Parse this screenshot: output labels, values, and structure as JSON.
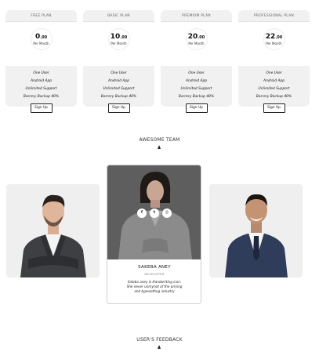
{
  "pricing": {
    "plans": [
      {
        "name": "FREE PLAN",
        "price": "0",
        "cents": ".00",
        "period": "Per Month",
        "features": [
          "One User",
          "Android App",
          "Unlimited Support",
          "Barrery Backup 40%"
        ],
        "cta": "Sign Up"
      },
      {
        "name": "BASIC PLAN",
        "price": "10",
        "cents": ".00",
        "period": "Per Month",
        "features": [
          "One User",
          "Android App",
          "Unlimited Support",
          "Barrery Backup 40%"
        ],
        "cta": "Sign Up"
      },
      {
        "name": "PREMIUM PLAN",
        "price": "20",
        "cents": ".00",
        "period": "Per Month",
        "features": [
          "One User",
          "Android App",
          "Unlimited Support",
          "Barrery Backup 40%"
        ],
        "cta": "Sign Up"
      },
      {
        "name": "PROFESSIONAL PLAN",
        "price": "22",
        "cents": ".00",
        "period": "Per Month",
        "features": [
          "One User",
          "Android App",
          "Unlimited Support",
          "Barrery Backup 40%"
        ],
        "cta": "Sign Up"
      }
    ]
  },
  "team": {
    "title": "AWESOME TEAM",
    "featured": {
      "name": "SAKEBA ANEY",
      "role": "DEVELOPER",
      "bio": "Saleba aney is Handwriting icon. She never unmynot of the prining and typesetting industry",
      "social_icons": [
        "facebook-icon",
        "twitter-icon",
        "instagram-icon"
      ]
    }
  },
  "feedback": {
    "title": "USER'S FEEDBACK"
  },
  "colors": {
    "card_bg": "#efefef",
    "accent": "#222222",
    "overlay": "#5c5c5c"
  }
}
